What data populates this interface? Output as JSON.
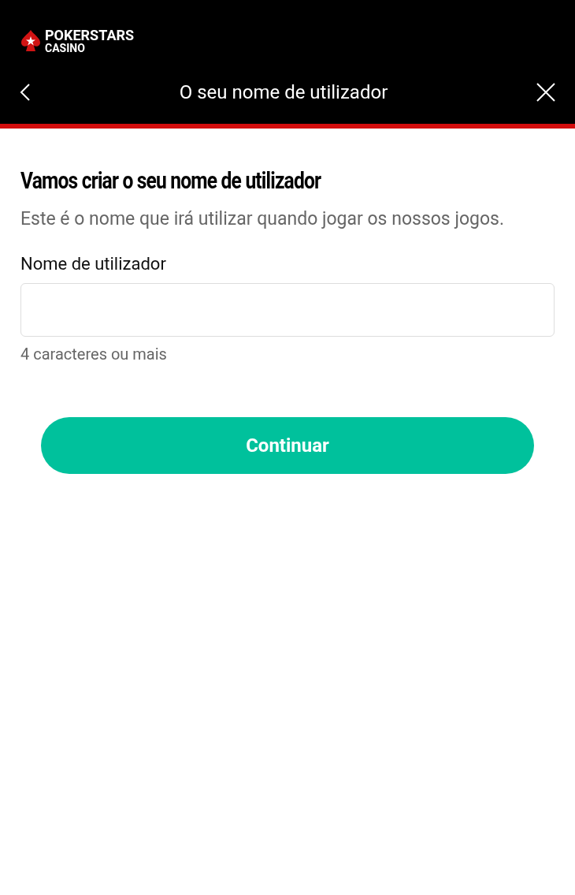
{
  "brand": {
    "name": "POKERSTARS",
    "sub": "CASINO"
  },
  "header": {
    "title": "O seu nome de utilizador"
  },
  "heading": "Vamos criar o seu nome de utilizador",
  "intro": "Este é o nome que irá utilizar quando jogar os nossos jogos.",
  "field": {
    "label": "Nome de utilizador",
    "hint": "4 caracteres ou mais"
  },
  "button": "Continuar"
}
